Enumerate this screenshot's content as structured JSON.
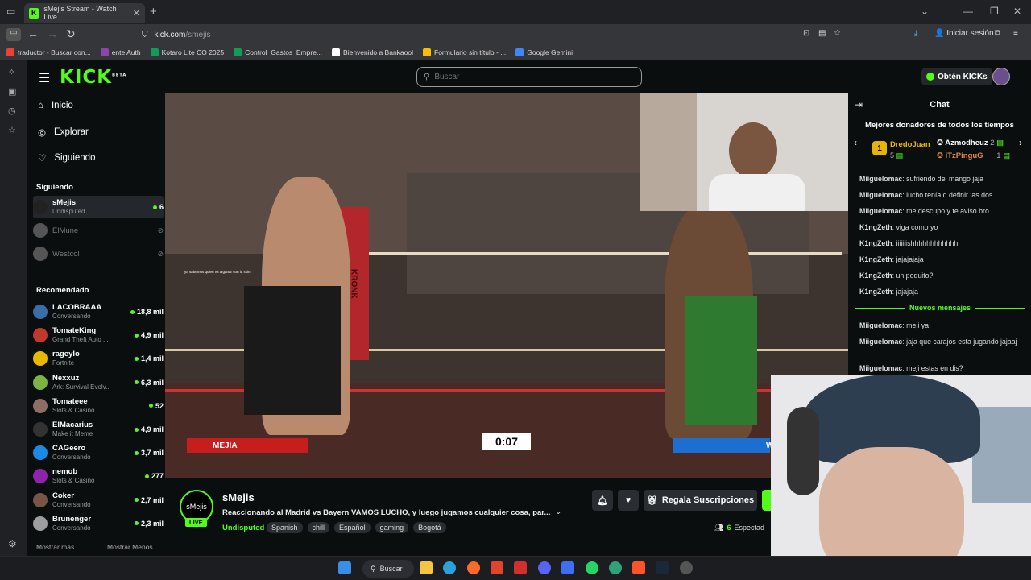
{
  "browser": {
    "tab_title": "sMejis Stream - Watch Live",
    "url_domain": "kick.com",
    "url_path": "/smejis",
    "login_label": "Iniciar sesión",
    "bookmarks": [
      {
        "label": "traductor - Buscar con...",
        "color": "#ea4335"
      },
      {
        "label": "ente Auth",
        "color": "#8e44ad"
      },
      {
        "label": "Kotaro Lite CO 2025",
        "color": "#0f9d58"
      },
      {
        "label": "Control_Gastos_Empre...",
        "color": "#0f9d58"
      },
      {
        "label": "Bienvenido a Bankaool",
        "color": "#ffffff"
      },
      {
        "label": "Formulario sin título - ...",
        "color": "#fbbc05"
      },
      {
        "label": "Google Gemini",
        "color": "#4285f4"
      }
    ]
  },
  "header": {
    "logo": "KICK",
    "logo_beta": "BETA",
    "search_placeholder": "Buscar",
    "get_kicks": "Obtén KICKs"
  },
  "sidebar": {
    "nav": [
      "Inicio",
      "Explorar",
      "Siguiendo"
    ],
    "following_title": "Siguiendo",
    "following": [
      {
        "name": "sMejis",
        "sub": "Undisputed",
        "count": "6",
        "color": "#222"
      },
      {
        "name": "ElMune",
        "sub": "",
        "count": "",
        "color": "#555"
      },
      {
        "name": "Westcol",
        "sub": "",
        "count": "",
        "color": "#555"
      }
    ],
    "recommended_title": "Recomendado",
    "recommended": [
      {
        "name": "LACOBRAAA",
        "sub": "Conversando",
        "count": "18,8 mil",
        "color": "#3a6ea5"
      },
      {
        "name": "TomateKing",
        "sub": "Grand Theft Auto ...",
        "count": "4,9 mil",
        "color": "#c0392b"
      },
      {
        "name": "rageylo",
        "sub": "Fortnite",
        "count": "1,4 mil",
        "color": "#e6b800"
      },
      {
        "name": "Nexxuz",
        "sub": "Ark: Survival Evolv...",
        "count": "6,3 mil",
        "color": "#7cb342"
      },
      {
        "name": "Tomateee",
        "sub": "Slots & Casino",
        "count": "52",
        "color": "#8d6e63"
      },
      {
        "name": "ElMacarius",
        "sub": "Make it Meme",
        "count": "4,9 mil",
        "color": "#333"
      },
      {
        "name": "CAGeero",
        "sub": "Conversando",
        "count": "3,7 mil",
        "color": "#1e88e5"
      },
      {
        "name": "nemob",
        "sub": "Slots & Casino",
        "count": "277",
        "color": "#8e24aa"
      },
      {
        "name": "Coker",
        "sub": "Conversando",
        "count": "2,7 mil",
        "color": "#795548"
      },
      {
        "name": "Brunenger",
        "sub": "Conversando",
        "count": "2,3 mil",
        "color": "#9e9e9e"
      }
    ],
    "show_more": "Mostrar más",
    "show_less": "Mostrar Menos"
  },
  "video": {
    "timer": "0:07",
    "left_fighter": "MEJÍA",
    "right_fighter_initial": "W",
    "game_caption": "ya sabemos quien va a ganar con la skin"
  },
  "chat": {
    "title": "Chat",
    "donors_title": "Mejores donadores de todos los tiempos",
    "donors": [
      {
        "rank": "1",
        "name": "DredoJuan",
        "amount": "5"
      },
      {
        "rank": "2",
        "name": "Azmodheuz",
        "amount": "2"
      },
      {
        "rank": "3",
        "name": "iTzPinguG",
        "amount": "1"
      }
    ],
    "messages": [
      {
        "user": "Miiguelomac",
        "text": "sufriendo del mango jaja"
      },
      {
        "user": "Miiguelomac",
        "text": "lucho tenía q definir las dos"
      },
      {
        "user": "Miiguelomac",
        "text": "me descupo y te aviso bro"
      },
      {
        "user": "K1ngZeth",
        "text": "viga como yo"
      },
      {
        "user": "K1ngZeth",
        "text": "iiiiiiishhhhhhhhhhhh"
      },
      {
        "user": "K1ngZeth",
        "text": "jajajajaja"
      },
      {
        "user": "K1ngZeth",
        "text": "un poquito?"
      },
      {
        "user": "K1ngZeth",
        "text": "jajajaja"
      }
    ],
    "new_messages": "Nuevos mensajes",
    "new": [
      {
        "user": "Miiguelomac",
        "text": "meji ya"
      },
      {
        "user": "Miiguelomac",
        "text": "jaja que carajos esta jugando jajaaj"
      },
      {
        "user": "Miiguelomac",
        "text": "meji estas en dis?"
      }
    ]
  },
  "stream": {
    "avatar_text": "sMejis",
    "live": "LIVE",
    "name": "sMejis",
    "title": "Reaccionando al Madrid vs Bayern VAMOS LUCHO, y luego jugamos cualquier cosa, par...",
    "category": "Undisputed",
    "tags": [
      "Spanish",
      "chill",
      "Español",
      "gaming",
      "Bogotá"
    ],
    "gift_label": "Regala Suscripciones",
    "viewers_count": "6",
    "viewers_label": "Espectad"
  },
  "taskbar": {
    "search": "Buscar"
  }
}
